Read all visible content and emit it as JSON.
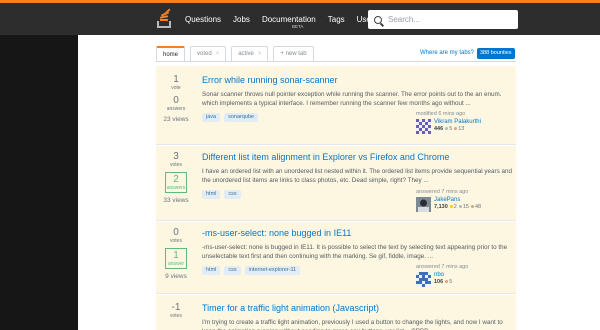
{
  "nav": {
    "items": [
      "Questions",
      "Jobs",
      "Documentation",
      "Tags",
      "Users"
    ],
    "beta": "BETA",
    "search_placeholder": "Search..."
  },
  "tabs": [
    {
      "label": "home"
    },
    {
      "label": "voted",
      "close": "×"
    },
    {
      "label": "active",
      "close": "×"
    },
    {
      "label": "+ new tab"
    }
  ],
  "where_link": "Where are my tabs?",
  "bounties_badge": "388 bounties",
  "questions": [
    {
      "votes": "1",
      "votes_label": "vote",
      "answers": "0",
      "answers_label": "answers",
      "views": "23 views",
      "title": "Error while running sonar-scanner",
      "excerpt": "Sonar scanner throws null pointer exception while running the scanner. The error points out to the an enum. which implements a typical interface. I remember running the scanner few months ago without ...",
      "tags": [
        "java",
        "sonarqube"
      ],
      "action": "modified 6 mins ago",
      "user": "Vikram Palakurthi",
      "rep": "446",
      "badges": {
        "silver": "5",
        "bronze": "13"
      }
    },
    {
      "votes": "3",
      "votes_label": "votes",
      "answers": "2",
      "answers_label": "answers",
      "views": "33 views",
      "title": "Different list item alignment in Explorer vs Firefox and Chrome",
      "excerpt": "I have an ordered list with an unordered list nested within it. The ordered list items provide sequential years and the unordered list items are links to class photos, etc. Dead simple, right? They ...",
      "tags": [
        "html",
        "css"
      ],
      "action": "answered 7 mins ago",
      "user": "JakePans",
      "rep": "7,130",
      "badges": {
        "gold": "2",
        "silver": "15",
        "bronze": "48"
      }
    },
    {
      "votes": "0",
      "votes_label": "votes",
      "answers": "1",
      "answers_label": "answer",
      "views": "9 views",
      "title": "-ms-user-select: none bugged in IE11",
      "excerpt": "-ms-user-select: none is bugged in IE11. It is possible to select the text by selecting text appearing prior to the unselectable text first and then continuing with the marking. Se gif, fiddle, image. ...",
      "tags": [
        "html",
        "css",
        "internet-explorer-11"
      ],
      "action": "answered 7 mins ago",
      "user": "nbo",
      "rep": "106",
      "badges": {
        "bronze": "5"
      }
    },
    {
      "votes": "-1",
      "votes_label": "votes",
      "title": "Timer for a traffic light animation (Javascript)",
      "excerpt": "I'm trying to create a traffic light animation, previously I used a button to change the lights, and now I want to keep the animation running without needing to press any buttons. var list = CBBB"
    }
  ],
  "colors": {
    "accent": "#f48024",
    "link": "#0077cc",
    "answered": "#5eba7d",
    "row_bg": "#fdf7e2"
  }
}
